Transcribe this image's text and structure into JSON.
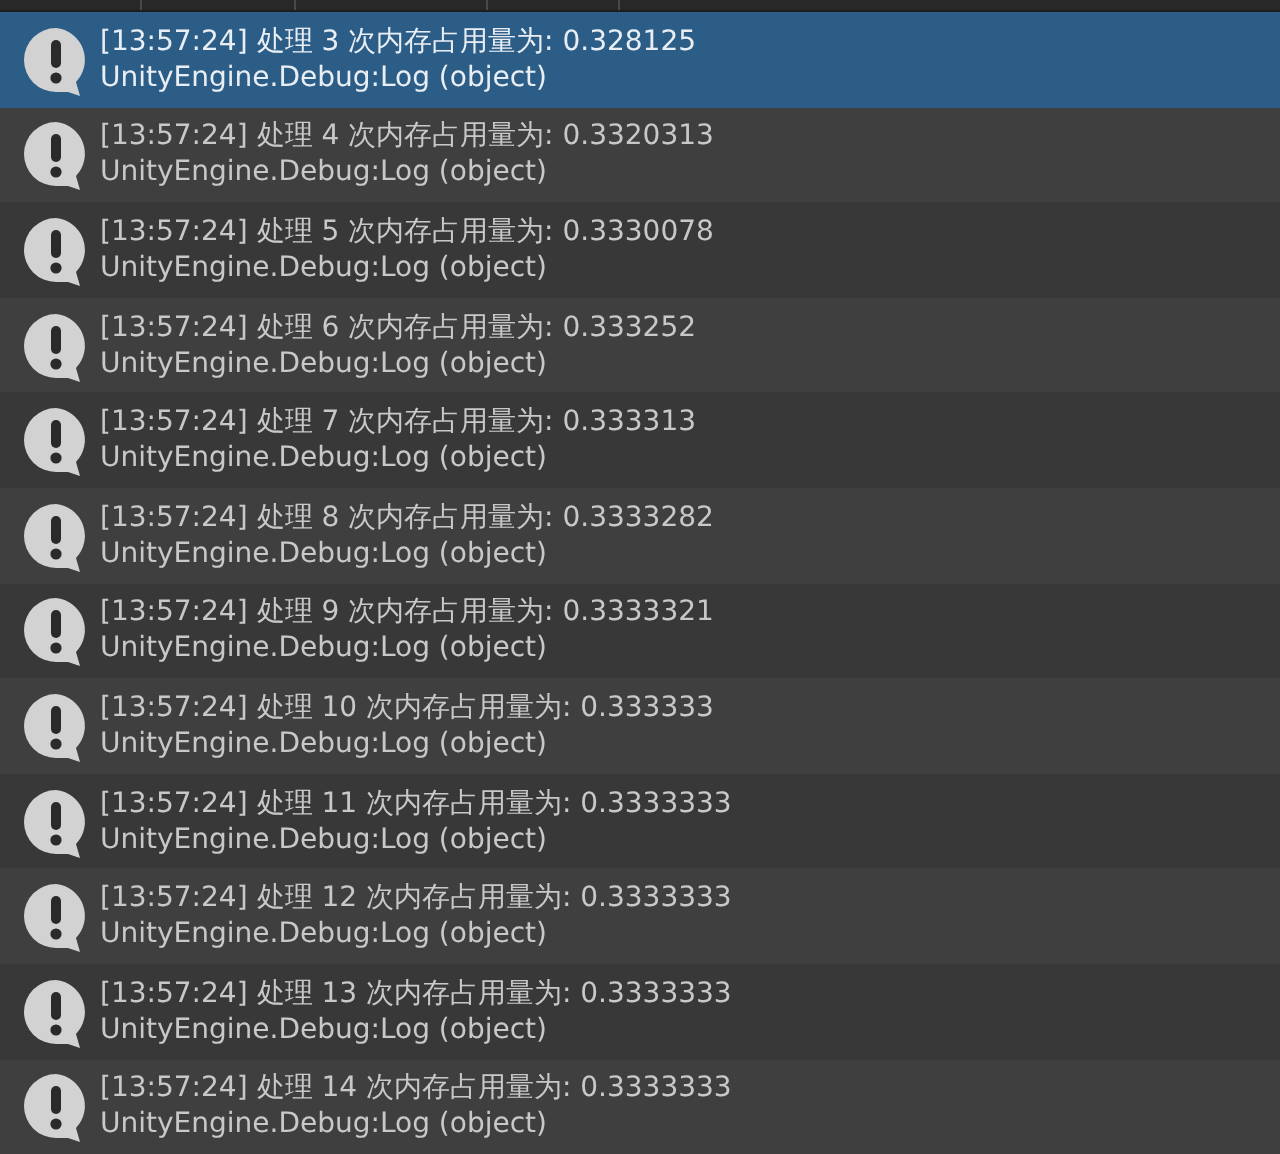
{
  "log_entries": [
    {
      "message": "[13:57:24] 处理 3 次内存占用量为: 0.328125",
      "source": "UnityEngine.Debug:Log (object)",
      "selected": true
    },
    {
      "message": "[13:57:24] 处理 4 次内存占用量为: 0.3320313",
      "source": "UnityEngine.Debug:Log (object)",
      "selected": false
    },
    {
      "message": "[13:57:24] 处理 5 次内存占用量为: 0.3330078",
      "source": "UnityEngine.Debug:Log (object)",
      "selected": false
    },
    {
      "message": "[13:57:24] 处理 6 次内存占用量为: 0.333252",
      "source": "UnityEngine.Debug:Log (object)",
      "selected": false
    },
    {
      "message": "[13:57:24] 处理 7 次内存占用量为: 0.333313",
      "source": "UnityEngine.Debug:Log (object)",
      "selected": false
    },
    {
      "message": "[13:57:24] 处理 8 次内存占用量为: 0.3333282",
      "source": "UnityEngine.Debug:Log (object)",
      "selected": false
    },
    {
      "message": "[13:57:24] 处理 9 次内存占用量为: 0.3333321",
      "source": "UnityEngine.Debug:Log (object)",
      "selected": false
    },
    {
      "message": "[13:57:24] 处理 10 次内存占用量为: 0.333333",
      "source": "UnityEngine.Debug:Log (object)",
      "selected": false
    },
    {
      "message": "[13:57:24] 处理 11 次内存占用量为: 0.3333333",
      "source": "UnityEngine.Debug:Log (object)",
      "selected": false
    },
    {
      "message": "[13:57:24] 处理 12 次内存占用量为: 0.3333333",
      "source": "UnityEngine.Debug:Log (object)",
      "selected": false
    },
    {
      "message": "[13:57:24] 处理 13 次内存占用量为: 0.3333333",
      "source": "UnityEngine.Debug:Log (object)",
      "selected": false
    },
    {
      "message": "[13:57:24] 处理 14 次内存占用量为: 0.3333333",
      "source": "UnityEngine.Debug:Log (object)",
      "selected": false
    }
  ]
}
